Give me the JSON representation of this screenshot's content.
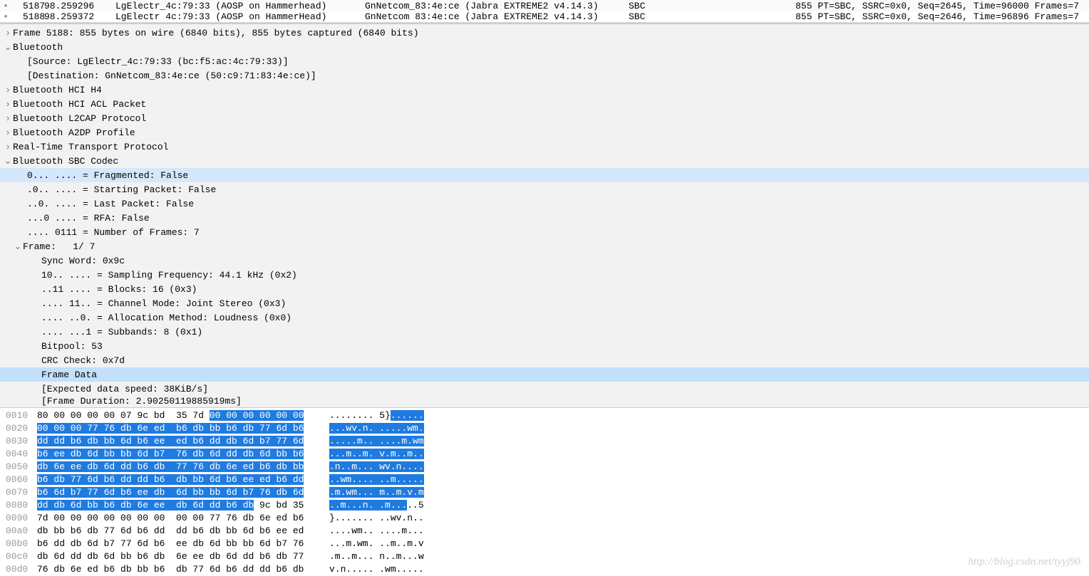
{
  "packet_list": [
    {
      "dot": "•",
      "num": "5187",
      "time": "98.259296",
      "src": "LgElectr_4c:79:33 (AOSP on Hammerhead)",
      "dst": "GnNetcom_83:4e:ce (Jabra EXTREME2 v4.14.3)",
      "proto": "SBC",
      "info": "855 PT=SBC, SSRC=0x0, Seq=2645, Time=96000 Frames=7"
    },
    {
      "dot": "•",
      "num": "5188",
      "time": "98.259372",
      "src": "LgElectr 4c:79:33 (AOSP on HammerHead)",
      "dst": "GnNetcom 83:4e:ce (Jabra EXTREME2 v4.14.3)",
      "proto": "SBC",
      "info": "855 PT=SBC, SSRC=0x0, Seq=2646, Time=96896 Frames=7"
    }
  ],
  "tree": {
    "frame_summary": "Frame 5188: 855 bytes on wire (6840 bits), 855 bytes captured (6840 bits)",
    "bluetooth": "Bluetooth",
    "bt_source": "[Source: LgElectr_4c:79:33 (bc:f5:ac:4c:79:33)]",
    "bt_dest": "[Destination: GnNetcom_83:4e:ce (50:c9:71:83:4e:ce)]",
    "hci_h4": "Bluetooth HCI H4",
    "hci_acl": "Bluetooth HCI ACL Packet",
    "l2cap": "Bluetooth L2CAP Protocol",
    "a2dp": "Bluetooth A2DP Profile",
    "rtp": "Real-Time Transport Protocol",
    "sbc": "Bluetooth SBC Codec",
    "sbc_frag": "0... .... = Fragmented: False",
    "sbc_start": ".0.. .... = Starting Packet: False",
    "sbc_last": "..0. .... = Last Packet: False",
    "sbc_rfa": "...0 .... = RFA: False",
    "sbc_nframes": ".... 0111 = Number of Frames: 7",
    "sbc_frame": "Frame:   1/ 7",
    "sbc_sync": "Sync Word: 0x9c",
    "sbc_sf": "10.. .... = Sampling Frequency: 44.1 kHz (0x2)",
    "sbc_blocks": "..11 .... = Blocks: 16 (0x3)",
    "sbc_cm": ".... 11.. = Channel Mode: Joint Stereo (0x3)",
    "sbc_am": ".... ..0. = Allocation Method: Loudness (0x0)",
    "sbc_sb": ".... ...1 = Subbands: 8 (0x1)",
    "sbc_bp": "Bitpool: 53",
    "sbc_crc": "CRC Check: 0x7d",
    "sbc_fd": "Frame Data",
    "sbc_speed": "[Expected data speed: 38KiB/s]",
    "sbc_dur": "[Frame Duration: 2.90250119885919ms]"
  },
  "hex": [
    {
      "off": "0010",
      "ba": "80 00 00 00 00 07 9c bd  35 7d ",
      "bb": "00 00 00 00 00 00",
      "aa": "........ 5}",
      "ab": "......"
    },
    {
      "off": "0020",
      "ba": "",
      "bb": "00 00 00 77 76 db 6e ed  b6 db bb b6 db 77 6d b6",
      "aa": "",
      "ab": "...wv.n. .....wm."
    },
    {
      "off": "0030",
      "ba": "",
      "bb": "dd dd b6 db bb 6d b6 ee  ed b6 dd db 6d b7 77 6d",
      "aa": "",
      "ab": ".....m.. ....m.wm"
    },
    {
      "off": "0040",
      "ba": "",
      "bb": "b6 ee db 6d bb bb 6d b7  76 db 6d dd db 6d bb b6",
      "aa": "",
      "ab": "...m..m. v.m..m.."
    },
    {
      "off": "0050",
      "ba": "",
      "bb": "db 6e ee db 6d dd b6 db  77 76 db 6e ed b6 db bb",
      "aa": "",
      "ab": ".n..m... wv.n...."
    },
    {
      "off": "0060",
      "ba": "",
      "bb": "b6 db 77 6d b6 dd dd b6  db bb 6d b6 ee ed b6 dd",
      "aa": "",
      "ab": "..wm.... ..m....."
    },
    {
      "off": "0070",
      "ba": "",
      "bb": "b6 6d b7 77 6d b6 ee db  6d bb bb 6d b7 76 db 6d",
      "aa": "",
      "ab": ".m.wm... m..m.v.m"
    },
    {
      "off": "0080",
      "ba": "",
      "bb": "dd db 6d bb b6 db 6e ee  db 6d dd b6 db",
      "bc": " 9c bd 35",
      "aa": "",
      "ab": "..m...n. .m...",
      "ac": "..5"
    },
    {
      "off": "0090",
      "ba": "7d 00 00 00 00 00 00 00  00 00 77 76 db 6e ed b6",
      "bb": "",
      "aa": "}....... ..wv.n..",
      "ab": ""
    },
    {
      "off": "00a0",
      "ba": "db bb b6 db 77 6d b6 dd  dd b6 db bb 6d b6 ee ed",
      "bb": "",
      "aa": "....wm.. ....m...",
      "ab": ""
    },
    {
      "off": "00b0",
      "ba": "b6 dd db 6d b7 77 6d b6  ee db 6d bb bb 6d b7 76",
      "bb": "",
      "aa": "...m.wm. ..m..m.v",
      "ab": ""
    },
    {
      "off": "00c0",
      "ba": "db 6d dd db 6d bb b6 db  6e ee db 6d dd b6 db 77",
      "bb": "",
      "aa": ".m..m... n..m...w",
      "ab": ""
    },
    {
      "off": "00d0",
      "ba": "76 db 6e ed b6 db bb b6  db 77 6d b6 dd dd b6 db",
      "bb": "",
      "aa": "v.n..... .wm.....",
      "ab": ""
    }
  ],
  "watermark": "http://blog.csdn.net/tyyj90"
}
